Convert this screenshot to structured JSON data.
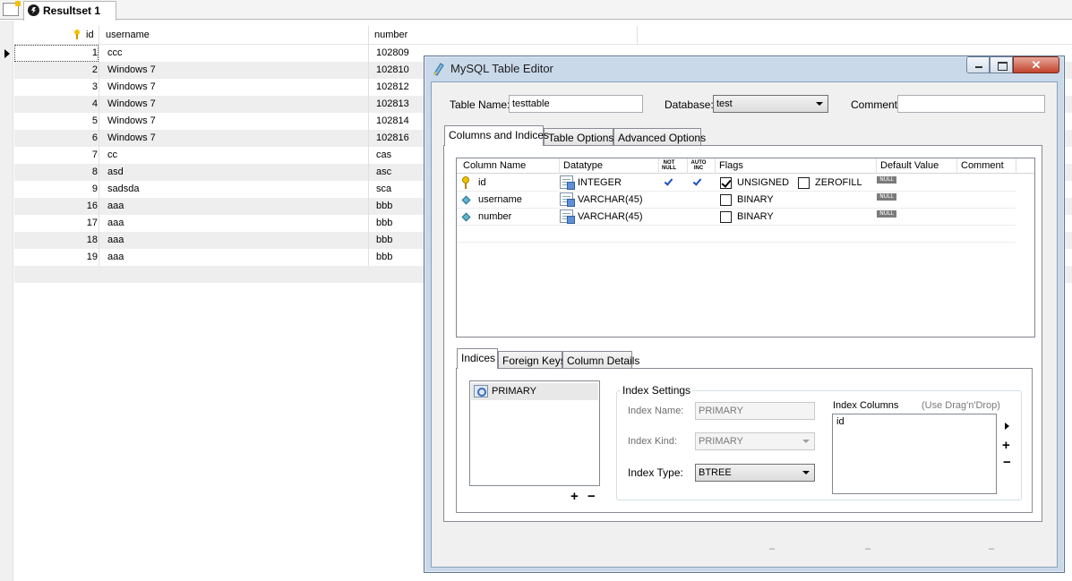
{
  "resultset": {
    "tab_label": "Resultset 1",
    "columns": [
      "id",
      "username",
      "number"
    ],
    "rows": [
      {
        "id": "1",
        "username": "ccc",
        "number": "102809"
      },
      {
        "id": "2",
        "username": "Windows 7",
        "number": "102810"
      },
      {
        "id": "3",
        "username": "Windows 7",
        "number": "102812"
      },
      {
        "id": "4",
        "username": "Windows 7",
        "number": "102813"
      },
      {
        "id": "5",
        "username": "Windows 7",
        "number": "102814"
      },
      {
        "id": "6",
        "username": "Windows 7",
        "number": "102816"
      },
      {
        "id": "7",
        "username": "cc",
        "number": "cas"
      },
      {
        "id": "8",
        "username": "asd",
        "number": "asc"
      },
      {
        "id": "9",
        "username": "sadsda",
        "number": "sca"
      },
      {
        "id": "16",
        "username": "aaa",
        "number": "bbb"
      },
      {
        "id": "17",
        "username": "aaa",
        "number": "bbb"
      },
      {
        "id": "18",
        "username": "aaa",
        "number": "bbb"
      },
      {
        "id": "19",
        "username": "aaa",
        "number": "bbb"
      }
    ]
  },
  "dialog": {
    "title": "MySQL Table Editor",
    "close_label": "✕",
    "table_name_label": "Table Name:",
    "table_name_value": "testtable",
    "database_label": "Database:",
    "database_value": "test",
    "comment_label": "Comment:",
    "comment_value": "",
    "tabs": [
      "Columns and Indices",
      "Table Options",
      "Advanced Options"
    ],
    "columns_header": {
      "name": "Column Name",
      "datatype": "Datatype",
      "not_null": "NOT\nNULL",
      "auto_inc": "AUTO\nINC",
      "flags": "Flags",
      "default": "Default Value",
      "comment": "Comment"
    },
    "columns": [
      {
        "name": "id",
        "datatype": "INTEGER",
        "not_null": true,
        "auto_inc": true,
        "flags": [
          {
            "label": "UNSIGNED",
            "checked": true
          },
          {
            "label": "ZEROFILL",
            "checked": false
          }
        ],
        "default": "NULL",
        "icon": "key-icon"
      },
      {
        "name": "username",
        "datatype": "VARCHAR(45)",
        "not_null": false,
        "auto_inc": false,
        "flags": [
          {
            "label": "BINARY",
            "checked": false
          }
        ],
        "default": "NULL",
        "icon": "diamond-icon"
      },
      {
        "name": "number",
        "datatype": "VARCHAR(45)",
        "not_null": false,
        "auto_inc": false,
        "flags": [
          {
            "label": "BINARY",
            "checked": false
          }
        ],
        "default": "NULL",
        "icon": "diamond-icon"
      }
    ],
    "sub_tabs": [
      "Indices",
      "Foreign Keys",
      "Column Details"
    ],
    "indices": [
      "PRIMARY"
    ],
    "index_settings": {
      "title": "Index Settings",
      "name_label": "Index Name:",
      "name_value": "PRIMARY",
      "kind_label": "Index Kind:",
      "kind_value": "PRIMARY",
      "type_label": "Index Type:",
      "type_value": "BTREE",
      "columns_label": "Index Columns",
      "columns_hint": "(Use Drag'n'Drop)",
      "columns": [
        "id"
      ]
    },
    "plus": "+",
    "minus": "−",
    "footer_dashes": [
      "–",
      "–",
      "–"
    ]
  }
}
